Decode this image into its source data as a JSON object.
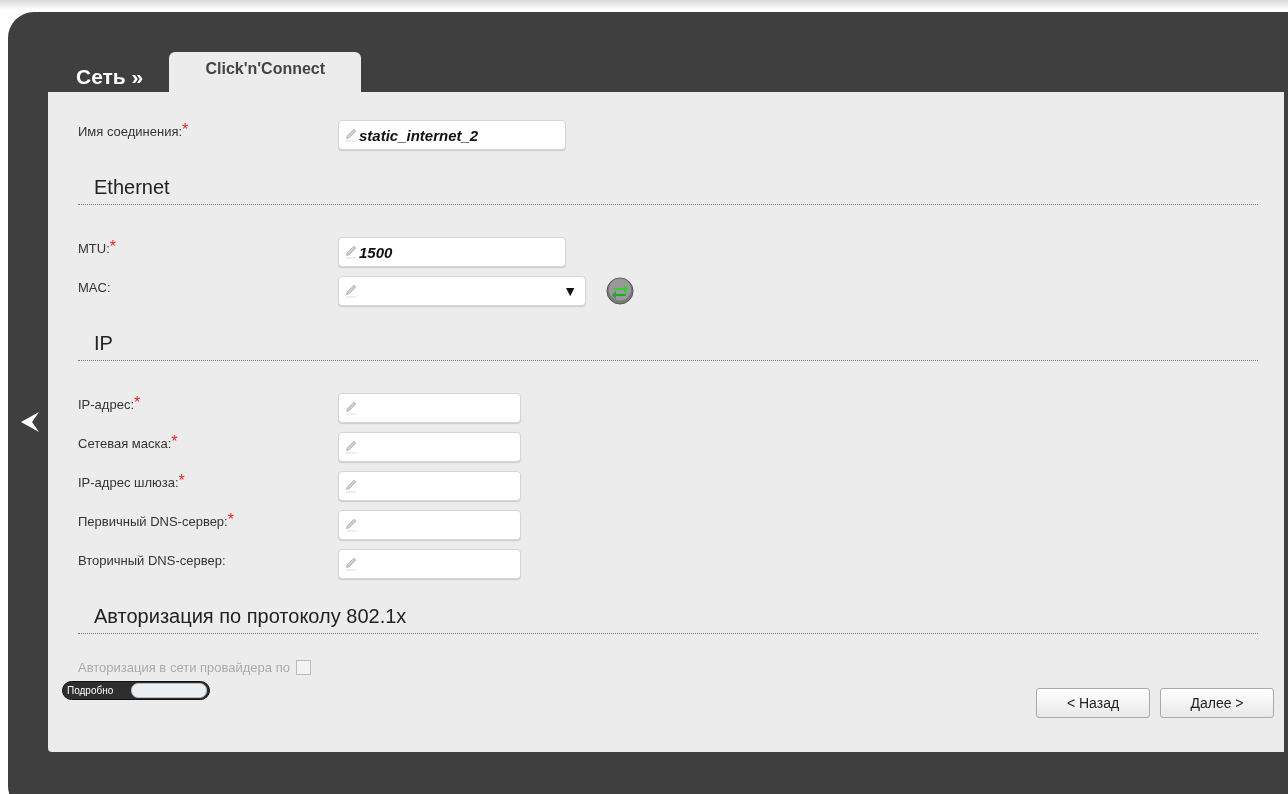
{
  "breadcrumb": "Сеть »",
  "tabs": [
    {
      "label": "Click'n'Connect",
      "selected": true
    }
  ],
  "sections": [
    {
      "fields": [
        {
          "kind": "text",
          "label": "Имя соединения:",
          "required_mark": "*",
          "value": "static_internet_2"
        }
      ]
    },
    {
      "title": "Ethernet",
      "fields": [
        {
          "kind": "text",
          "label": "MTU:",
          "required_mark": "*",
          "value": "1500"
        },
        {
          "kind": "select",
          "label": "MAC:",
          "arrow": "▼"
        }
      ]
    },
    {
      "title": "IP",
      "fields": [
        {
          "kind": "text",
          "label": "IP-адрес:",
          "required_mark": "*"
        },
        {
          "kind": "text",
          "label": "Сетевая маска:",
          "required_mark": "*"
        },
        {
          "kind": "text",
          "label": "IP-адрес шлюза:",
          "required_mark": "*"
        },
        {
          "kind": "text",
          "label": "Первичный DNS-сервер:",
          "required_mark": "*"
        },
        {
          "kind": "text",
          "label": "Вторичный DNS-сервер:"
        }
      ]
    },
    {
      "title": "Авторизация по протоколу 802.1x",
      "fields": [
        {
          "kind": "checkbox",
          "label": "Авторизация в сети провайдера по",
          "checked": false,
          "disabled": true
        }
      ]
    }
  ],
  "details_toggle": {
    "label": "Подробно",
    "on": false
  },
  "buttons": [
    {
      "label": "< Назад"
    },
    {
      "label": "Далее >"
    }
  ]
}
